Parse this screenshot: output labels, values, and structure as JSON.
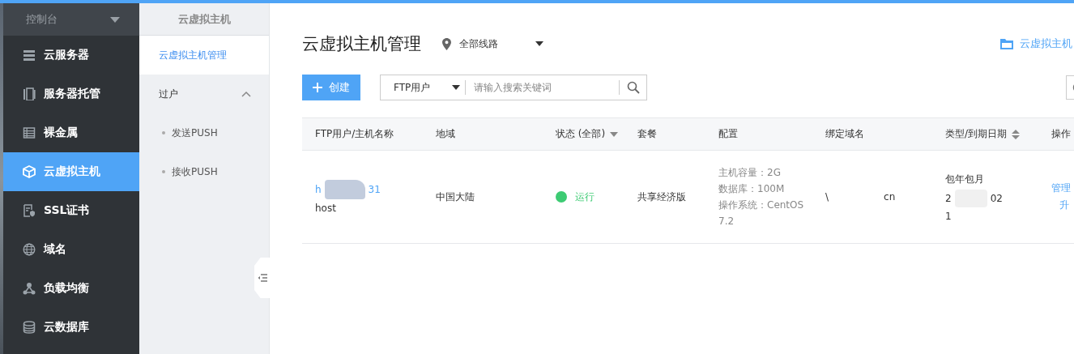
{
  "sidebar": {
    "header": "控制台",
    "items": [
      {
        "label": "云服务器",
        "selected": false
      },
      {
        "label": "服务器托管",
        "selected": false
      },
      {
        "label": "裸金属",
        "selected": false
      },
      {
        "label": "云虚拟主机",
        "selected": true
      },
      {
        "label": "SSL证书",
        "selected": false
      },
      {
        "label": "域名",
        "selected": false
      },
      {
        "label": "负载均衡",
        "selected": false
      },
      {
        "label": "云数据库",
        "selected": false
      }
    ]
  },
  "subnav": {
    "title": "云虚拟主机",
    "items": [
      {
        "label": "云虚拟主机管理",
        "selected": true
      }
    ],
    "group": {
      "label": "过户",
      "expanded": true,
      "children": [
        {
          "label": "发送PUSH"
        },
        {
          "label": "接收PUSH"
        }
      ]
    }
  },
  "main": {
    "title": "云虚拟主机管理",
    "region": "全部线路",
    "link": "云虚拟主机",
    "create_button": "创建",
    "search": {
      "type": "FTP用户",
      "placeholder": "请输入搜索关键词"
    },
    "table": {
      "columns": [
        "FTP用户/主机名称",
        "地域",
        "状态 (全部)",
        "套餐",
        "配置",
        "绑定域名",
        "类型/到期日期",
        "操作"
      ],
      "rows": [
        {
          "name_parts": [
            "h",
            "31"
          ],
          "host": "host",
          "region": "中国大陆",
          "status": {
            "label": "运行",
            "kind": "running"
          },
          "plan": "共享经济版",
          "config": [
            "主机容量：2G",
            "数据库：100M",
            "操作系统：CentOS 7.2"
          ],
          "domain_parts": [
            "\\",
            "cn"
          ],
          "billing": "包年包月",
          "date_parts": [
            "2",
            "02"
          ],
          "date_line2": "1",
          "actions": [
            "管理",
            "升"
          ]
        }
      ]
    }
  }
}
